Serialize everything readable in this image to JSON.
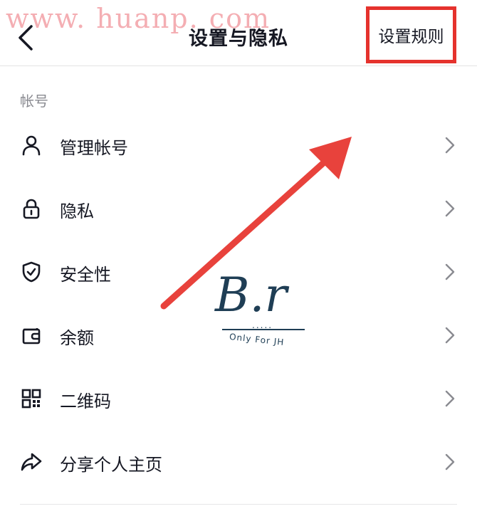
{
  "header": {
    "title": "设置与隐私",
    "rules_label": "设置规则"
  },
  "watermark": {
    "url": "www. huanp. com",
    "logo_text": "B.r",
    "logo_dots": ".....",
    "logo_sub": "Only For JH"
  },
  "section": {
    "label": "帐号"
  },
  "items": [
    {
      "label": "管理帐号",
      "icon": "person-icon"
    },
    {
      "label": "隐私",
      "icon": "lock-icon"
    },
    {
      "label": "安全性",
      "icon": "shield-check-icon"
    },
    {
      "label": "余额",
      "icon": "wallet-icon"
    },
    {
      "label": "二维码",
      "icon": "qr-code-icon"
    },
    {
      "label": "分享个人主页",
      "icon": "share-icon"
    }
  ],
  "colors": {
    "highlight": "#e5322d",
    "text": "#161823",
    "muted": "#8a8b91",
    "arrow": "#e8423c"
  }
}
